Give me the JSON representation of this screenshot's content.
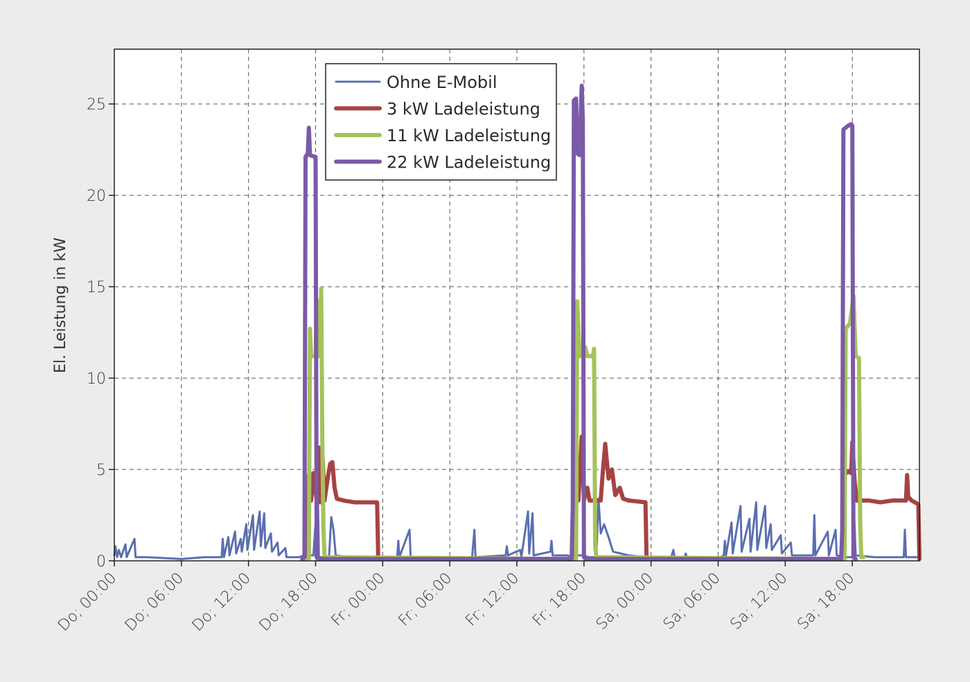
{
  "chart_data": {
    "type": "line",
    "title": "",
    "xlabel": "",
    "ylabel": "El. Leistung in kW",
    "xlim": [
      0,
      72
    ],
    "ylim": [
      0,
      28
    ],
    "grid": true,
    "legend_position": "top-center",
    "x_tick_labels": [
      "Do; 00:00",
      "Do; 06:00",
      "Do; 12:00",
      "Do; 18:00",
      "Fr; 00:00",
      "Fr; 06:00",
      "Fr; 12:00",
      "Fr; 18:00",
      "Sa; 00:00",
      "Sa; 06:00",
      "Sa; 12:00",
      "Sa; 18:00"
    ],
    "x_tick_hours": [
      0,
      6,
      12,
      18,
      24,
      30,
      36,
      42,
      48,
      54,
      60,
      66
    ],
    "y_ticks": [
      0,
      5,
      10,
      15,
      20,
      25
    ],
    "series": [
      {
        "name": "Ohne E-Mobil",
        "color": "#5b6fb0",
        "width": 3,
        "points": [
          [
            0,
            0.3
          ],
          [
            0.1,
            0.8
          ],
          [
            0.25,
            0.2
          ],
          [
            0.4,
            0.6
          ],
          [
            0.6,
            0.2
          ],
          [
            1.0,
            0.9
          ],
          [
            1.1,
            0.2
          ],
          [
            1.8,
            1.2
          ],
          [
            1.9,
            0.2
          ],
          [
            3,
            0.2
          ],
          [
            6,
            0.1
          ],
          [
            8,
            0.2
          ],
          [
            9.6,
            0.2
          ],
          [
            9.7,
            1.2
          ],
          [
            9.8,
            0.2
          ],
          [
            10.2,
            1.3
          ],
          [
            10.3,
            0.3
          ],
          [
            10.8,
            1.6
          ],
          [
            10.9,
            0.4
          ],
          [
            11.3,
            1.2
          ],
          [
            11.4,
            0.5
          ],
          [
            11.8,
            2.0
          ],
          [
            11.9,
            0.6
          ],
          [
            12.4,
            2.5
          ],
          [
            12.5,
            0.6
          ],
          [
            13.0,
            2.7
          ],
          [
            13.1,
            0.8
          ],
          [
            13.4,
            2.6
          ],
          [
            13.5,
            0.7
          ],
          [
            14.0,
            1.5
          ],
          [
            14.1,
            0.5
          ],
          [
            14.6,
            1.0
          ],
          [
            14.7,
            0.3
          ],
          [
            15.3,
            0.7
          ],
          [
            15.4,
            0.2
          ],
          [
            16.5,
            0.2
          ],
          [
            17.0,
            0.3
          ],
          [
            17.8,
            0.3
          ],
          [
            18.2,
            3.9
          ],
          [
            18.3,
            0.2
          ],
          [
            19.2,
            0.2
          ],
          [
            19.4,
            2.4
          ],
          [
            19.6,
            1.7
          ],
          [
            19.8,
            0.3
          ],
          [
            21,
            0.2
          ],
          [
            24,
            0.1
          ],
          [
            25.3,
            0.2
          ],
          [
            25.4,
            1.1
          ],
          [
            25.5,
            0.2
          ],
          [
            26.4,
            1.7
          ],
          [
            26.5,
            0.2
          ],
          [
            28,
            0.2
          ],
          [
            30,
            0.1
          ],
          [
            32.0,
            0.2
          ],
          [
            32.2,
            1.7
          ],
          [
            32.3,
            0.2
          ],
          [
            35.0,
            0.3
          ],
          [
            35.1,
            0.8
          ],
          [
            35.2,
            0.3
          ],
          [
            36.3,
            0.6
          ],
          [
            36.4,
            0.2
          ],
          [
            37.0,
            2.7
          ],
          [
            37.1,
            0.4
          ],
          [
            37.4,
            2.6
          ],
          [
            37.5,
            0.3
          ],
          [
            39.0,
            0.5
          ],
          [
            39.1,
            1.1
          ],
          [
            39.2,
            0.3
          ],
          [
            40.5,
            0.3
          ],
          [
            41.0,
            0.2
          ],
          [
            41.2,
            2.8
          ],
          [
            41.3,
            0.3
          ],
          [
            42.0,
            0.3
          ],
          [
            42.4,
            0.2
          ],
          [
            43.1,
            0.2
          ],
          [
            43.3,
            3.4
          ],
          [
            43.5,
            1.5
          ],
          [
            43.8,
            2.0
          ],
          [
            44.2,
            1.3
          ],
          [
            44.6,
            0.5
          ],
          [
            46,
            0.3
          ],
          [
            47.5,
            0.2
          ],
          [
            48,
            0.1
          ],
          [
            49.8,
            0.2
          ],
          [
            50.0,
            0.6
          ],
          [
            50.1,
            0.2
          ],
          [
            51.0,
            0.2
          ],
          [
            51.1,
            0.4
          ],
          [
            51.2,
            0.2
          ],
          [
            52.0,
            0.2
          ],
          [
            54,
            0.1
          ],
          [
            54.5,
            0.3
          ],
          [
            54.6,
            1.1
          ],
          [
            54.7,
            0.3
          ],
          [
            55.2,
            2.1
          ],
          [
            55.3,
            0.4
          ],
          [
            56.0,
            3.0
          ],
          [
            56.1,
            0.5
          ],
          [
            56.8,
            2.3
          ],
          [
            56.9,
            0.5
          ],
          [
            57.4,
            3.2
          ],
          [
            57.5,
            0.6
          ],
          [
            58.2,
            3.0
          ],
          [
            58.3,
            0.7
          ],
          [
            58.7,
            2.0
          ],
          [
            58.8,
            0.6
          ],
          [
            59.6,
            1.4
          ],
          [
            59.7,
            0.4
          ],
          [
            60.5,
            1.0
          ],
          [
            60.6,
            0.3
          ],
          [
            62.5,
            0.3
          ],
          [
            62.6,
            2.5
          ],
          [
            62.7,
            0.3
          ],
          [
            63.8,
            1.6
          ],
          [
            63.9,
            0.3
          ],
          [
            64.5,
            1.7
          ],
          [
            64.6,
            0.3
          ],
          [
            65.2,
            0.2
          ],
          [
            66.0,
            0.2
          ],
          [
            66.1,
            3.5
          ],
          [
            66.3,
            0.3
          ],
          [
            68,
            0.2
          ],
          [
            70.6,
            0.2
          ],
          [
            70.7,
            1.7
          ],
          [
            70.8,
            0.2
          ],
          [
            72,
            0.2
          ]
        ]
      },
      {
        "name": "3 kW Ladeleistung",
        "color": "#a54343",
        "width": 6,
        "points": [
          [
            17,
            0.1
          ],
          [
            17.3,
            0.1
          ],
          [
            17.4,
            4.7
          ],
          [
            17.6,
            3.3
          ],
          [
            17.8,
            4.8
          ],
          [
            18.1,
            3.3
          ],
          [
            18.3,
            6.2
          ],
          [
            18.4,
            3.2
          ],
          [
            18.6,
            6.0
          ],
          [
            18.8,
            3.3
          ],
          [
            19.1,
            4.6
          ],
          [
            19.3,
            5.3
          ],
          [
            19.5,
            5.4
          ],
          [
            19.7,
            4.0
          ],
          [
            19.9,
            3.4
          ],
          [
            20.5,
            3.3
          ],
          [
            21.5,
            3.2
          ],
          [
            22.5,
            3.2
          ],
          [
            23.5,
            3.2
          ],
          [
            23.6,
            0.1
          ],
          [
            24,
            0.1
          ],
          [
            41.2,
            0.1
          ],
          [
            41.3,
            6.2
          ],
          [
            41.5,
            3.3
          ],
          [
            41.8,
            6.8
          ],
          [
            42.0,
            3.3
          ],
          [
            42.3,
            4.0
          ],
          [
            42.5,
            3.3
          ],
          [
            43.0,
            3.3
          ],
          [
            43.5,
            3.3
          ],
          [
            43.7,
            5.0
          ],
          [
            43.9,
            6.4
          ],
          [
            44.2,
            4.5
          ],
          [
            44.5,
            5.0
          ],
          [
            44.8,
            3.6
          ],
          [
            45.2,
            4.0
          ],
          [
            45.5,
            3.4
          ],
          [
            46.0,
            3.3
          ],
          [
            47.5,
            3.2
          ],
          [
            47.6,
            0.1
          ],
          [
            48.0,
            0.1
          ],
          [
            65.2,
            0.1
          ],
          [
            65.3,
            4.7
          ],
          [
            65.6,
            4.9
          ],
          [
            65.9,
            4.8
          ],
          [
            66.0,
            6.5
          ],
          [
            66.2,
            4.4
          ],
          [
            66.4,
            3.3
          ],
          [
            67.5,
            3.3
          ],
          [
            68.5,
            3.2
          ],
          [
            69.6,
            3.3
          ],
          [
            70.8,
            3.3
          ],
          [
            70.9,
            4.7
          ],
          [
            71.0,
            3.5
          ],
          [
            71.3,
            3.3
          ],
          [
            71.9,
            3.1
          ],
          [
            72.0,
            0.1
          ]
        ]
      },
      {
        "name": "11 kW Ladeleistung",
        "color": "#a5c25a",
        "width": 6,
        "points": [
          [
            17,
            0.1
          ],
          [
            17.4,
            0.1
          ],
          [
            17.5,
            12.7
          ],
          [
            17.6,
            11.2
          ],
          [
            18.0,
            11.2
          ],
          [
            18.1,
            14.3
          ],
          [
            18.2,
            11.2
          ],
          [
            18.3,
            13.0
          ],
          [
            18.4,
            11.2
          ],
          [
            18.5,
            14.9
          ],
          [
            18.6,
            6.7
          ],
          [
            18.7,
            1.8
          ],
          [
            18.8,
            0.2
          ],
          [
            19.2,
            0.2
          ],
          [
            41.3,
            0.1
          ],
          [
            41.4,
            14.2
          ],
          [
            41.6,
            11.2
          ],
          [
            42.0,
            11.2
          ],
          [
            42.1,
            11.7
          ],
          [
            42.3,
            11.2
          ],
          [
            42.8,
            11.2
          ],
          [
            42.9,
            11.6
          ],
          [
            43.0,
            0.9
          ],
          [
            43.1,
            0.2
          ],
          [
            65.3,
            0.1
          ],
          [
            65.4,
            12.7
          ],
          [
            65.8,
            13.0
          ],
          [
            66.1,
            14.5
          ],
          [
            66.3,
            11.2
          ],
          [
            66.6,
            11.1
          ],
          [
            66.7,
            2.1
          ],
          [
            66.8,
            0.2
          ],
          [
            67.0,
            0.2
          ]
        ]
      },
      {
        "name": "22 kW Ladeleistung",
        "color": "#7b5aa6",
        "width": 6,
        "points": [
          [
            16.8,
            0.1
          ],
          [
            17.0,
            0.2
          ],
          [
            17.1,
            22.1
          ],
          [
            17.3,
            22.3
          ],
          [
            17.4,
            23.7
          ],
          [
            17.5,
            22.2
          ],
          [
            18.0,
            22.1
          ],
          [
            18.1,
            0.2
          ],
          [
            18.3,
            0.1
          ],
          [
            40.9,
            0.1
          ],
          [
            41.0,
            3.0
          ],
          [
            41.1,
            25.2
          ],
          [
            41.3,
            25.3
          ],
          [
            41.4,
            22.3
          ],
          [
            41.6,
            22.2
          ],
          [
            41.8,
            26.0
          ],
          [
            41.9,
            24.1
          ],
          [
            42.0,
            0.2
          ],
          [
            42.2,
            0.1
          ],
          [
            65.0,
            0.1
          ],
          [
            65.1,
            1.6
          ],
          [
            65.2,
            23.6
          ],
          [
            65.6,
            23.8
          ],
          [
            65.9,
            23.9
          ],
          [
            66.0,
            23.8
          ],
          [
            66.1,
            0.2
          ],
          [
            66.3,
            0.1
          ]
        ]
      }
    ]
  }
}
